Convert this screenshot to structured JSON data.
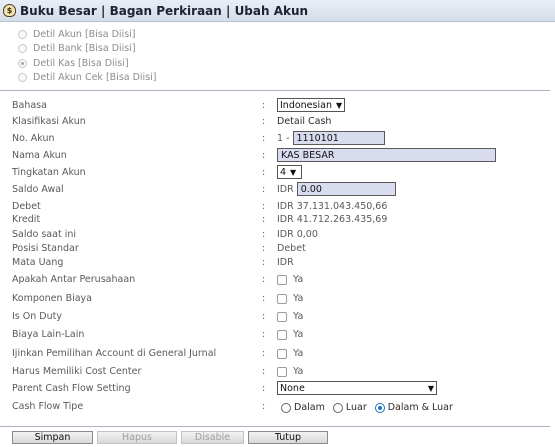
{
  "window": {
    "title": "Buku Besar | Bagan Perkiraan | Ubah Akun",
    "icon": "money-bag-icon"
  },
  "radios": [
    {
      "label": "Detil Akun [Bisa Diisi]",
      "checked": false
    },
    {
      "label": "Detil Bank [Bisa Diisi]",
      "checked": false
    },
    {
      "label": "Detil Kas [Bisa Diisi]",
      "checked": true
    },
    {
      "label": "Detil Akun Cek [Bisa Diisi]",
      "checked": false
    }
  ],
  "colon": ":",
  "form": {
    "bahasa": {
      "label": "Bahasa",
      "value": "Indonesian"
    },
    "klasifikasi": {
      "label": "Klasifikasi Akun",
      "value": "Detail Cash"
    },
    "no_akun": {
      "label": "No. Akun",
      "prefix": "1 -",
      "value": "1110101"
    },
    "nama_akun": {
      "label": "Nama Akun",
      "value": "KAS BESAR"
    },
    "tingkatan": {
      "label": "Tingkatan Akun",
      "value": "4"
    },
    "saldo_awal": {
      "label": "Saldo Awal",
      "currency": "IDR",
      "value": "0.00"
    },
    "debet": {
      "label": "Debet",
      "value": "IDR 37.131.043.450,66"
    },
    "kredit": {
      "label": "Kredit",
      "value": "IDR 41.712.263.435,69"
    },
    "saldo_saat_ini": {
      "label": "Saldo saat ini",
      "value": "IDR 0,00"
    },
    "posisi_standar": {
      "label": "Posisi Standar",
      "value": "Debet"
    },
    "mata_uang": {
      "label": "Mata Uang",
      "value": "IDR"
    },
    "antar_perusahaan": {
      "label": "Apakah Antar Perusahaan",
      "option": "Ya"
    },
    "komponen_biaya": {
      "label": "Komponen Biaya",
      "option": "Ya"
    },
    "is_on_duty": {
      "label": "Is On Duty",
      "option": "Ya"
    },
    "biaya_lain": {
      "label": "Biaya Lain-Lain",
      "option": "Ya"
    },
    "ijinkan_pemilihan": {
      "label": "Ijinkan Pemilihan Account di General Jurnal",
      "option": "Ya"
    },
    "cost_center": {
      "label": "Harus Memiliki Cost Center",
      "option": "Ya"
    },
    "parent_cash_flow": {
      "label": "Parent Cash Flow Setting",
      "value": "None"
    },
    "cash_flow_tipe": {
      "label": "Cash Flow Tipe",
      "options": [
        "Dalam",
        "Luar",
        "Dalam & Luar"
      ],
      "selected": "Dalam & Luar"
    }
  },
  "buttons": {
    "simpan": "Simpan",
    "hapus": "Hapus",
    "disable": "Disable",
    "tutup": "Tutup"
  }
}
